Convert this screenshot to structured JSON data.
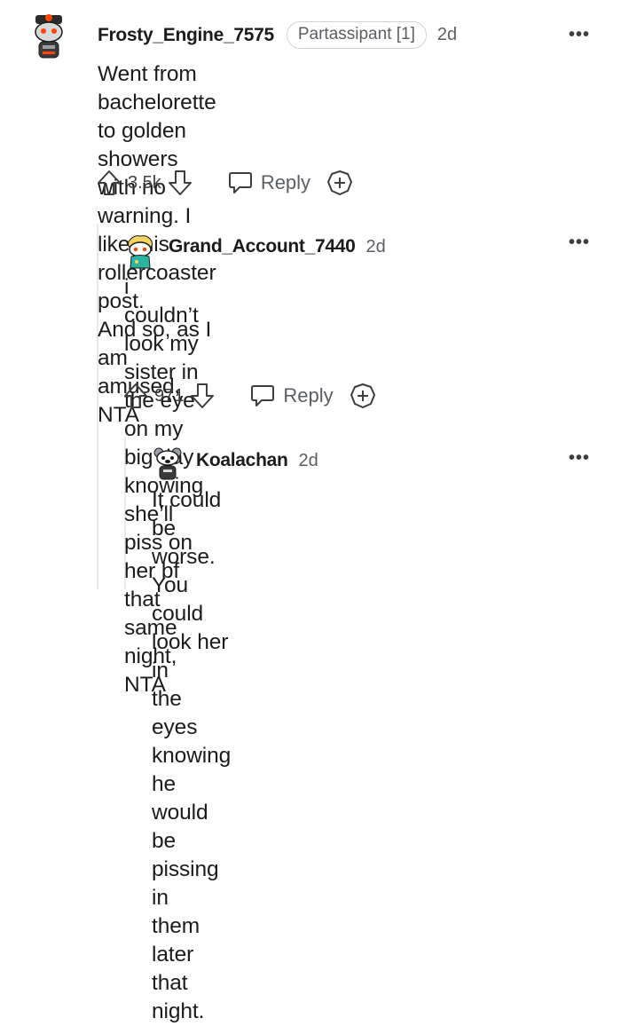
{
  "comments": [
    {
      "username": "Frosty_Engine_7575",
      "flair": "Partassipant [1]",
      "age": "2d",
      "body": "Went from bachelorette to golden showers\nwith no warning. I like this rollercoaster post.\nAnd so, as I am amused, NTA",
      "votes": "3.5k",
      "reply_label": "Reply",
      "more_label": "•••"
    },
    {
      "username": "Grand_Account_7440",
      "age": "2d",
      "body": "i couldn’t look my sister in the eye on my\nbig day knowing she’ll piss on her bf that\nsame night, NTA",
      "votes": "971",
      "reply_label": "Reply",
      "more_label": "•••"
    },
    {
      "username": "Koalachan",
      "age": "2d",
      "body": "It could be worse. You could look her in\nthe eyes knowing he would be pissing in\nthem later that night.",
      "more_label": "•••"
    }
  ],
  "colors": {
    "text": "#1c1c1c",
    "meta": "#5b5f63",
    "thread_line": "#e7e9eb",
    "avatar_orange": "#ff4500"
  },
  "icons": [
    "avatar-icon",
    "upvote-icon",
    "downvote-icon",
    "reply-icon",
    "award-icon",
    "more-icon"
  ]
}
